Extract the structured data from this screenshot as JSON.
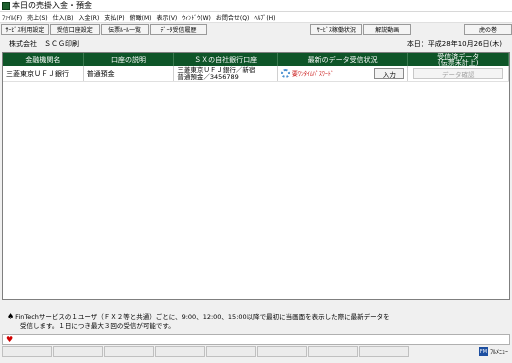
{
  "window": {
    "title": "本日の売掛入金・預金"
  },
  "menu": {
    "items": [
      "ﾌｧｲﾙ(F)",
      "売上(S)",
      "仕入(B)",
      "入金(R)",
      "支払(P)",
      "俯瞰(M)",
      "表示(V)",
      "ｳｨﾝﾄﾞｳ(W)",
      "お問合せ(Q)",
      "ﾍﾙﾌﾟ(H)"
    ]
  },
  "toolbar": {
    "service_settings": "ｻｰﾋﾞｽ利用設定",
    "receive_settings": "受信口座設定",
    "slip_list": "伝票ﾙｰﾙ一覧",
    "data_history": "ﾃﾞｰﾀ受信履歴",
    "service_status": "ｻｰﾋﾞｽ稼働状況",
    "explain_video": "解説動画",
    "tiger_scroll": "虎の巻"
  },
  "info": {
    "company": "株式会社　ＳＣＧ印刷",
    "date": "本日：平成28年10月26日(木)"
  },
  "grid": {
    "headers": {
      "bank": "金融機関名",
      "account_desc": "口座の説明",
      "sx_account": "ＳＸの自社銀行口座",
      "latest_status": "最新のデータ受信状況",
      "received_line1": "受信済データ",
      "received_line2": "(伝票未計上)"
    },
    "rows": [
      {
        "bank": "三菱東京ＵＦＪ銀行",
        "account_desc": "普通預金",
        "sx_line1": "三菱東京ＵＦＪ銀行／新宿",
        "sx_line2": "普通預金／3456789",
        "status": "要ﾜﾝﾀｲﾑﾊﾟｽﾜｰﾄﾞ",
        "receive_button": "入力",
        "confirm_button": "データ確認"
      }
    ]
  },
  "notice": {
    "spade": "♠",
    "line1": "FinTechサービスの１ユーザ（ＦＸ２等と共通）ごとに、9:00、12:00、15:00以降で最初に当画面を表示した際に最新データを",
    "line2": "受信します。１日につき最大３回の受信が可能です。"
  },
  "input": {
    "marker": "♥"
  },
  "footer": {
    "full_menu": "ﾌﾙﾒﾆｭｰ",
    "full_menu_icon": "FM"
  }
}
